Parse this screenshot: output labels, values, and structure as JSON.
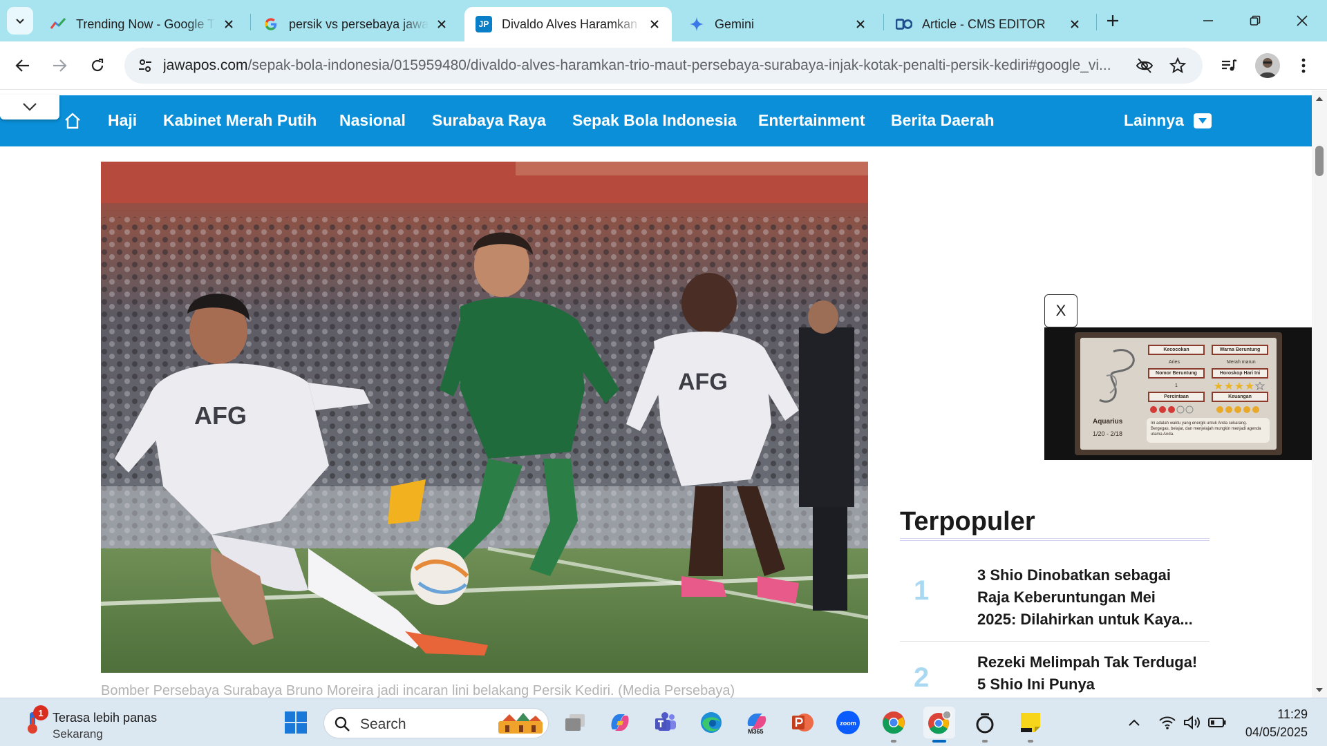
{
  "browser": {
    "tabs": [
      {
        "title": "Trending Now - Google T",
        "favicon": "google-trends-icon",
        "active": false
      },
      {
        "title": "persik vs persebaya jawa",
        "favicon": "google-g-icon",
        "active": false
      },
      {
        "title": "Divaldo Alves Haramkan",
        "favicon": "jawapos-icon",
        "favicon_text": "JP",
        "active": true
      },
      {
        "title": "Gemini",
        "favicon": "gemini-icon",
        "active": false
      },
      {
        "title": "Article - CMS EDITOR",
        "favicon": "cms-icon",
        "active": false
      }
    ],
    "address_bar": {
      "domain": "jawapos.com",
      "path": "/sepak-bola-indonesia/015959480/divaldo-alves-haramkan-trio-maut-persebaya-surabaya-injak-kotak-penalti-persik-kediri#google_vi..."
    }
  },
  "site": {
    "nav": {
      "items": [
        "Haji",
        "Kabinet Merah Putih",
        "Nasional",
        "Surabaya Raya",
        "Sepak Bola Indonesia",
        "Entertainment",
        "Berita Daerah"
      ],
      "more": "Lainnya"
    },
    "hero": {
      "caption": "Bomber Persebaya Surabaya Bruno Moreira jadi incaran lini belakang Persik Kediri. (Media Persebaya)",
      "jersey_left": "AFG",
      "jersey_right": "AFG"
    },
    "ad": {
      "close": "X",
      "sign": "Aquarius",
      "dates": "1/20 - 2/18",
      "labels": [
        "Kecocokan",
        "Warna Beruntung",
        "Nomor Beruntung",
        "Horoskop Hari Ini",
        "Percintaan",
        "Keuangan"
      ],
      "values": [
        "Aries",
        "Merah marun",
        "1"
      ],
      "note": "Ini adalah waktu yang energik untuk Anda sekarang. Bergegas, belajar, dan menjelajah mungkin menjadi agenda utama Anda."
    },
    "popular": {
      "title": "Terpopuler",
      "items": [
        {
          "rank": "1",
          "title": "3 Shio Dinobatkan sebagai Raja Keberuntungan Mei 2025: Dilahirkan untuk Kaya..."
        },
        {
          "rank": "2",
          "title": "Rezeki Melimpah Tak Terduga! 5 Shio Ini Punya"
        }
      ]
    }
  },
  "taskbar": {
    "weather": {
      "line1": "Terasa lebih panas",
      "line2": "Sekarang",
      "badge": "1"
    },
    "search_placeholder": "Search",
    "zoom_label": "zoom",
    "m365_label": "M365",
    "time": "11:29",
    "date": "04/05/2025"
  },
  "colors": {
    "tabstrip": "#a8e4f0",
    "nav": "#0a8fd8",
    "popular_rank": "#a9d9f2"
  }
}
